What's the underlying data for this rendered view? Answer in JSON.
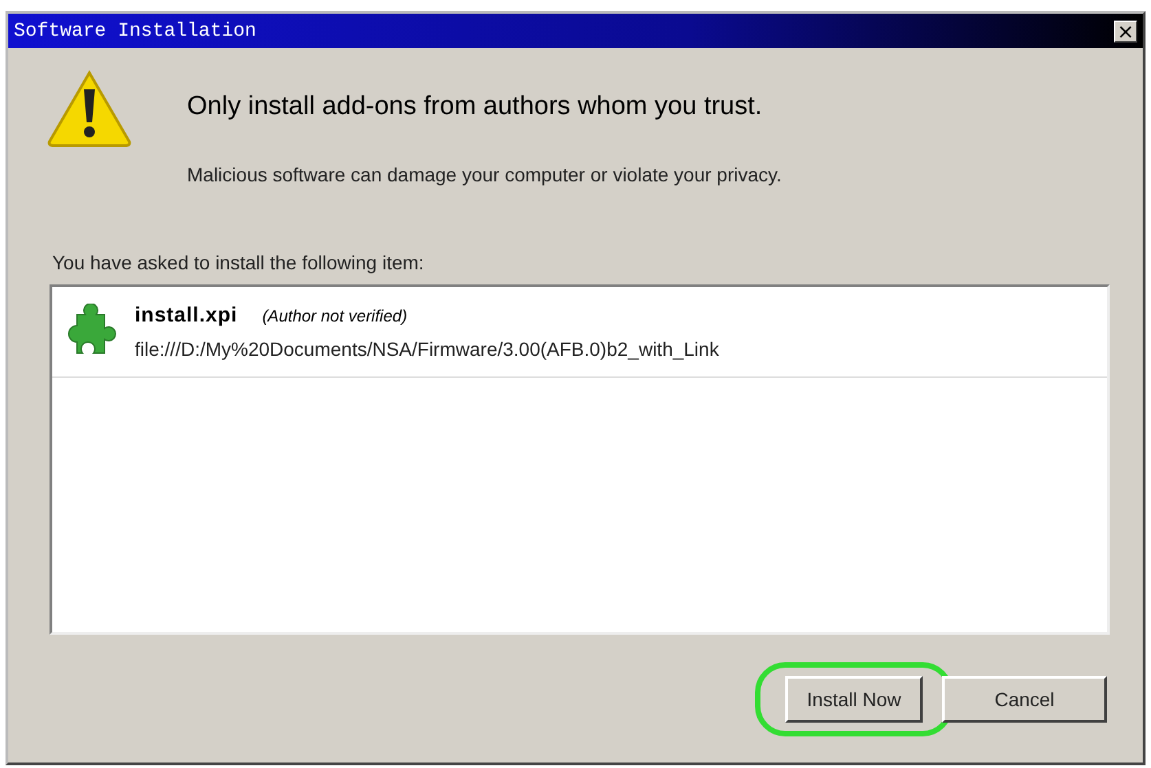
{
  "window": {
    "title": "Software Installation",
    "close": "×"
  },
  "warning": {
    "heading": "Only install add-ons from authors whom you trust.",
    "message": "Malicious software can damage your computer or violate your privacy."
  },
  "list": {
    "caption": "You have asked to install the following item:",
    "items": [
      {
        "name": "install.xpi",
        "note": "(Author not verified)",
        "url": "file:///D:/My%20Documents/NSA/Firmware/3.00(AFB.0)b2_with_Link"
      }
    ]
  },
  "buttons": [
    {
      "label": "Install Now",
      "highlighted": true
    },
    {
      "label": "Cancel",
      "highlighted": false
    }
  ]
}
